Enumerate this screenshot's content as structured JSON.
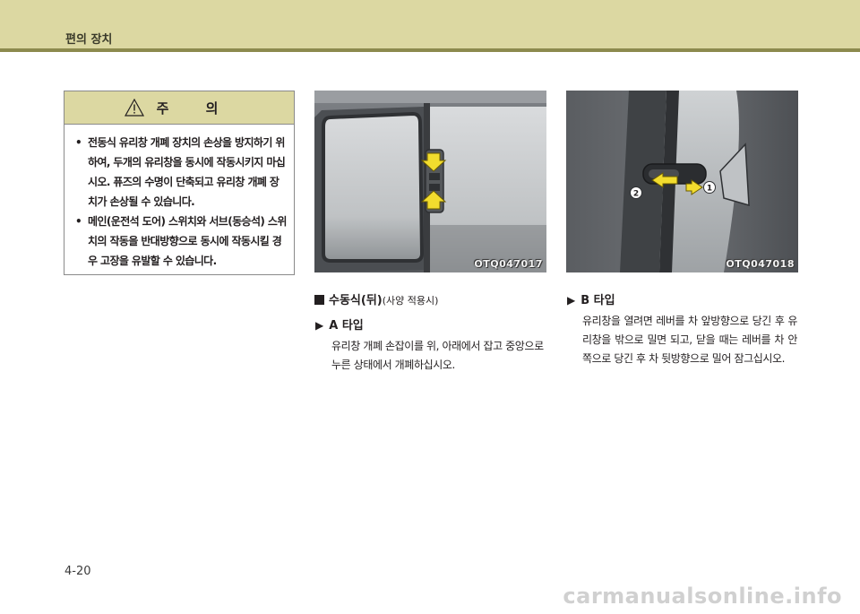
{
  "header": {
    "title": "편의 장치"
  },
  "caution": {
    "title": "주 의",
    "bullet": "•",
    "items": [
      "전동식 유리창 개폐 장치의 손상을 방지하기 위하여, 두개의 유리창을 동시에 작동시키지 마십시오. 퓨즈의 수명이 단축되고 유리창 개폐 장치가 손상될 수 있습니다.",
      "메인(운전석 도어) 스위치와 서브(동승석) 스위치의 작동을 반대방향으로 동시에 작동시킬 경우 고장을 유발할 수 있습니다."
    ]
  },
  "photos": {
    "a": {
      "code": "OTQ047017"
    },
    "b": {
      "code": "OTQ047018",
      "callouts": [
        "1",
        "2"
      ]
    }
  },
  "section": {
    "title": "수동식(뒤)",
    "subtitle": "(사양 적용시)"
  },
  "type_a": {
    "title": "A 타입",
    "text": "유리창 개폐 손잡이를 위, 아래에서 잡고 중앙으로 누른 상태에서 개폐하십시오."
  },
  "type_b": {
    "title": "B 타입",
    "text": "유리창을 열려면 레버를 차 앞방향으로 당긴 후 유리창을 밖으로 밀면 되고, 닫을 때는 레버를 차 안쪽으로 당긴 후 차 뒷방향으로 밀어 잠그십시오."
  },
  "page_number": "4-20",
  "watermark": "carmanualsonline.info",
  "colors": {
    "header_band": "#dcd8a2",
    "header_rule": "#8c8a4e",
    "callout_yellow": "#f2dc2e"
  }
}
